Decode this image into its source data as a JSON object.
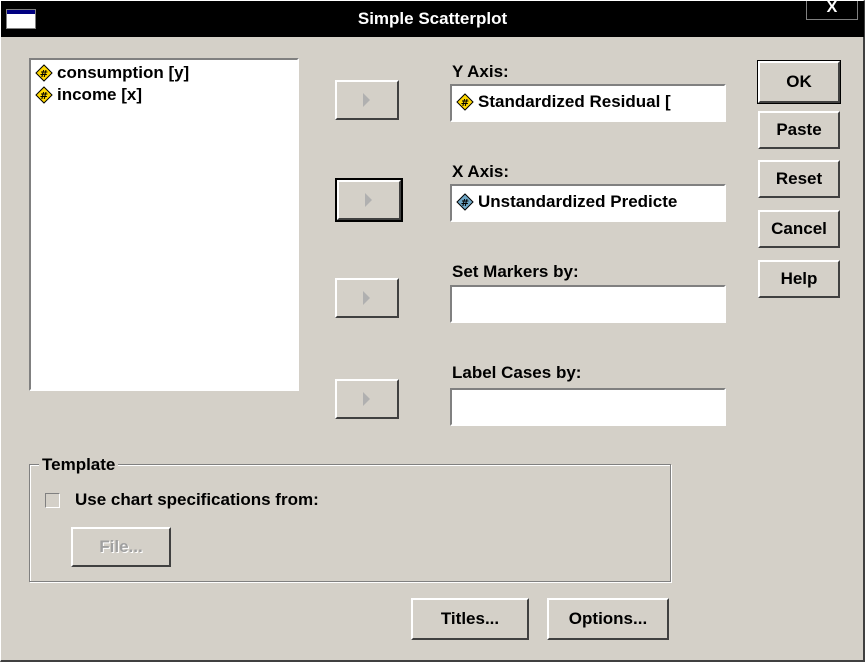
{
  "window": {
    "title": "Simple Scatterplot",
    "close_glyph": "X"
  },
  "variables": [
    {
      "label": "consumption [y]",
      "icon": "numeric-ruler-icon"
    },
    {
      "label": "income [x]",
      "icon": "numeric-ruler-icon"
    }
  ],
  "fields": {
    "y_axis": {
      "label": "Y Axis:",
      "value": "Standardized Residual [",
      "icon": "numeric-ruler-icon"
    },
    "x_axis": {
      "label": "X Axis:",
      "value": "Unstandardized Predicte",
      "icon": "numeric-scale-icon"
    },
    "markers": {
      "label": "Set Markers by:",
      "value": ""
    },
    "label_cases": {
      "label": "Label Cases by:",
      "value": ""
    }
  },
  "buttons": {
    "ok": "OK",
    "paste": "Paste",
    "reset": "Reset",
    "cancel": "Cancel",
    "help": "Help",
    "titles": "Titles...",
    "options": "Options..."
  },
  "template": {
    "title": "Template",
    "checkbox_label": "Use chart specifications from:",
    "checked": false,
    "file_button": "File..."
  },
  "colors": {
    "dialog_bg": "#d4d0c8",
    "titlebar_bg": "#000000",
    "ruler_icon_yellow": "#ffd800",
    "scale_icon_blue": "#6fa8c8"
  }
}
